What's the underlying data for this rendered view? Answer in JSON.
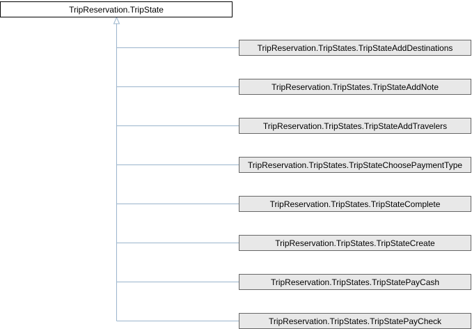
{
  "diagram": {
    "type": "inheritance",
    "colors": {
      "base_fill": "#ffffff",
      "base_stroke": "#000000",
      "child_fill": "#e8e8e8",
      "child_stroke": "#666666",
      "edge": "#9ab4cc"
    },
    "base": {
      "label": "TripReservation.TripState"
    },
    "children": [
      {
        "label": "TripReservation.TripStates.TripStateAddDestinations"
      },
      {
        "label": "TripReservation.TripStates.TripStateAddNote"
      },
      {
        "label": "TripReservation.TripStates.TripStateAddTravelers"
      },
      {
        "label": "TripReservation.TripStates.TripStateChoosePaymentType"
      },
      {
        "label": "TripReservation.TripStates.TripStateComplete"
      },
      {
        "label": "TripReservation.TripStates.TripStateCreate"
      },
      {
        "label": "TripReservation.TripStates.TripStatePayCash"
      },
      {
        "label": "TripReservation.TripStates.TripStatePayCheck"
      }
    ]
  }
}
